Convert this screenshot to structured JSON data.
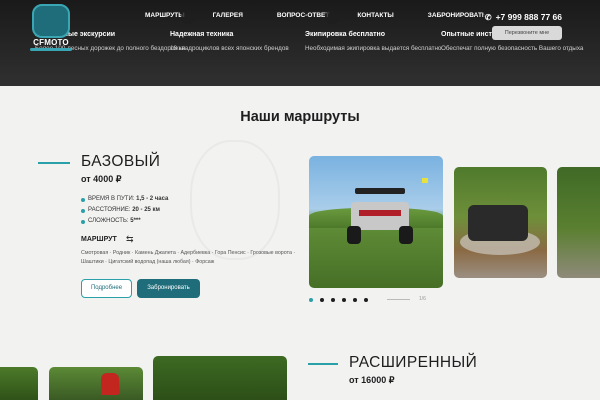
{
  "header": {
    "logo_text": "CFMOTO",
    "nav": [
      {
        "label": "Маршруты"
      },
      {
        "label": "Галерея"
      },
      {
        "label": "Вопрос-ответ"
      },
      {
        "label": "Контакты"
      },
      {
        "label": "Забронировать"
      }
    ],
    "phone": "+7 999 888 77 66",
    "callback_label": "Перезвоните мне",
    "features": [
      {
        "title": "Уникальные экскурсии",
        "text": "Более 100 лесных дорожек до полного бездорожья"
      },
      {
        "title": "Надежная техника",
        "text": "18 квадроциклов всех японских брендов"
      },
      {
        "title": "Экипировка бесплатно",
        "text": "Необходимая экипировка выдается бесплатно"
      },
      {
        "title": "Опытные инструкторы",
        "text": "Обеспечат полную безопасность Вашего отдыха"
      }
    ]
  },
  "section_title": "Наши маршруты",
  "routes": [
    {
      "name": "БАЗОВЫЙ",
      "price": "от 4000 ₽",
      "specs": [
        {
          "label": "Время в пути:",
          "value": "1,5 - 2 часа"
        },
        {
          "label": "Расстояние:",
          "value": "20 - 25 км"
        },
        {
          "label": "Сложность:",
          "value": "5***"
        }
      ],
      "route_label": "Маршрут",
      "path": "Смотровая · Родник · Камень Джапета · Адербиевка · Гора Пенсис · Грозовые ворота · Шаштики · Цигатский водопад (наша любая) · Форсаж",
      "btn_details": "Подробнее",
      "btn_book": "Забронировать"
    },
    {
      "name": "РАСШИРЕННЫЙ",
      "price": "от 16000 ₽"
    }
  ],
  "slider": {
    "counter": "1/6"
  },
  "icons": {
    "phone": "phone-icon",
    "route": "route-icon"
  },
  "colors": {
    "accent": "#2aa0a8",
    "primary_button": "#1f6d7a",
    "header_bg": "#3a3a3a"
  }
}
